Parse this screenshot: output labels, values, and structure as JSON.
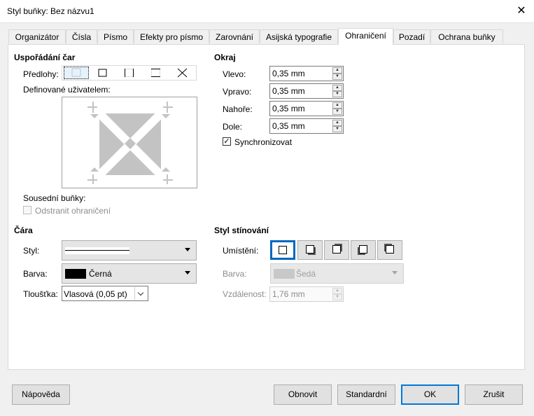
{
  "window": {
    "title": "Styl buňky: Bez názvu1",
    "close_glyph": "✕"
  },
  "tabs": [
    {
      "label": "Organizátor"
    },
    {
      "label": "Čísla"
    },
    {
      "label": "Písmo"
    },
    {
      "label": "Efekty pro písmo"
    },
    {
      "label": "Zarovnání"
    },
    {
      "label": "Asijská typografie"
    },
    {
      "label": "Ohraničení",
      "active": true
    },
    {
      "label": "Pozadí"
    },
    {
      "label": "Ochrana buňky"
    }
  ],
  "line_arrangement": {
    "title": "Uspořádání čar",
    "presets_label": "Předlohy:",
    "user_defined_label": "Definované uživatelem:",
    "adjacent_label": "Sousední buňky:",
    "remove_borders_label": "Odstranit ohraničení"
  },
  "padding": {
    "title": "Okraj",
    "left_label": "Vlevo:",
    "left_value": "0,35 mm",
    "right_label": "Vpravo:",
    "right_value": "0,35 mm",
    "top_label": "Nahoře:",
    "top_value": "0,35 mm",
    "bottom_label": "Dole:",
    "bottom_value": "0,35 mm",
    "sync_label": "Synchronizovat",
    "sync_checked": true,
    "check_glyph": "✓"
  },
  "line": {
    "title": "Čára",
    "style_label": "Styl:",
    "color_label": "Barva:",
    "color_value": "Černá",
    "color_swatch": "#000000",
    "width_label": "Tloušťka:",
    "width_value": "Vlasová (0,05 pt)"
  },
  "shadow": {
    "title": "Styl stínování",
    "position_label": "Umístění:",
    "color_label": "Barva:",
    "color_value": "Šedá",
    "color_swatch": "#c8c8c8",
    "distance_label": "Vzdálenost:",
    "distance_value": "1,76 mm"
  },
  "footer": {
    "help": "Nápověda",
    "reset": "Obnovit",
    "standard": "Standardní",
    "ok": "OK",
    "cancel": "Zrušit"
  },
  "colors": {
    "accent": "#0067c0",
    "preview_gray": "#c3c3c3"
  }
}
